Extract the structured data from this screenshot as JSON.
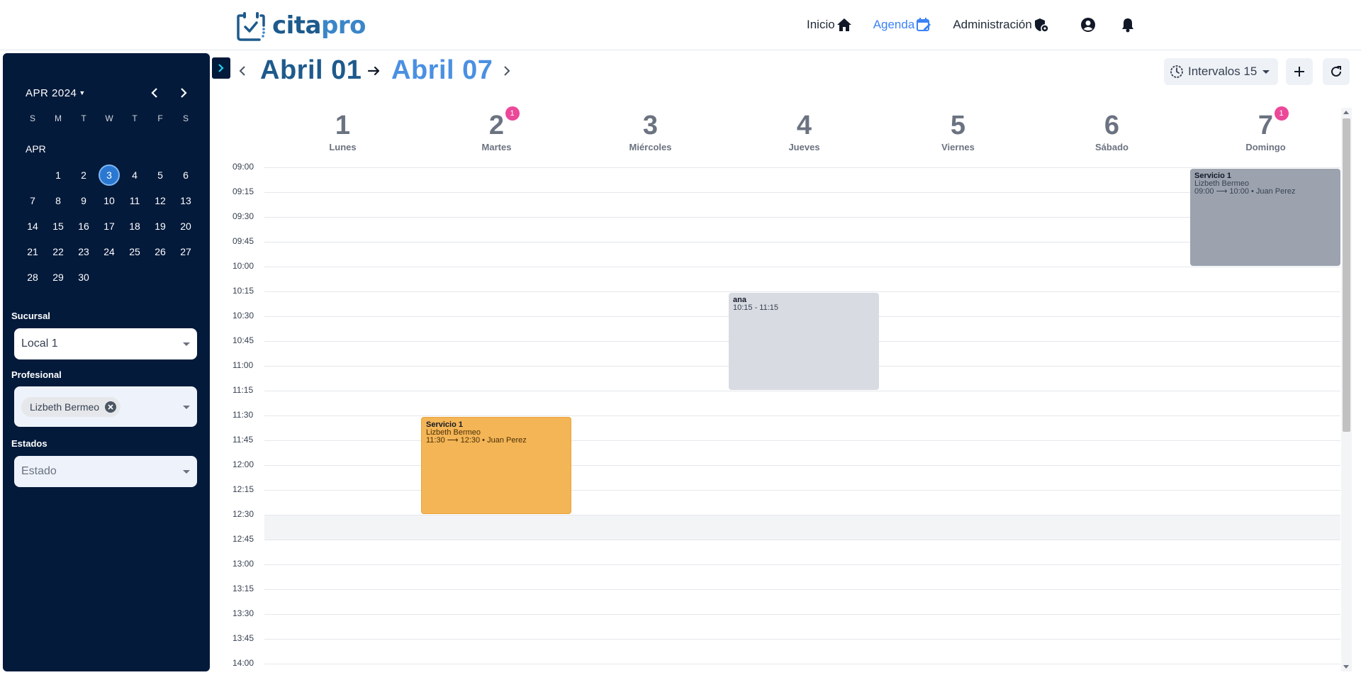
{
  "header": {
    "logo_text_1": "cita",
    "logo_text_2": "pro",
    "nav": [
      {
        "label": "Inicio",
        "icon": "home-icon",
        "active": false
      },
      {
        "label": "Agenda",
        "icon": "calendar-edit-icon",
        "active": true
      },
      {
        "label": "Administración",
        "icon": "shield-admin-icon",
        "active": false
      }
    ],
    "profile_icon": "user-circle-icon",
    "notifications_icon": "bell-icon"
  },
  "sidebar": {
    "mini_calendar": {
      "title": "APR 2024",
      "weekdays": [
        "S",
        "M",
        "T",
        "W",
        "T",
        "F",
        "S"
      ],
      "month_label": "APR",
      "weeks": [
        [
          "",
          "1",
          "2",
          "3",
          "4",
          "5",
          "6"
        ],
        [
          "7",
          "8",
          "9",
          "10",
          "11",
          "12",
          "13"
        ],
        [
          "14",
          "15",
          "16",
          "17",
          "18",
          "19",
          "20"
        ],
        [
          "21",
          "22",
          "23",
          "24",
          "25",
          "26",
          "27"
        ],
        [
          "28",
          "29",
          "30",
          "",
          "",
          "",
          ""
        ]
      ],
      "selected_day": "3"
    },
    "filters": {
      "sucursal_label": "Sucursal",
      "sucursal_value": "Local 1",
      "profesional_label": "Profesional",
      "profesional_chip": "Lizbeth Bermeo",
      "estados_label": "Estados",
      "estados_placeholder": "Estado"
    }
  },
  "toolbar": {
    "range_start": "Abril 01",
    "range_end": "Abril 07",
    "interval_label": "Intervalos 15"
  },
  "calendar": {
    "days": [
      {
        "num": "1",
        "name": "Lunes",
        "badge": ""
      },
      {
        "num": "2",
        "name": "Martes",
        "badge": "1"
      },
      {
        "num": "3",
        "name": "Miércoles",
        "badge": ""
      },
      {
        "num": "4",
        "name": "Jueves",
        "badge": ""
      },
      {
        "num": "5",
        "name": "Viernes",
        "badge": ""
      },
      {
        "num": "6",
        "name": "Sábado",
        "badge": ""
      },
      {
        "num": "7",
        "name": "Domingo",
        "badge": "1"
      }
    ],
    "times": [
      "09:00",
      "09:15",
      "09:30",
      "09:45",
      "10:00",
      "10:15",
      "10:30",
      "10:45",
      "11:00",
      "11:15",
      "11:30",
      "11:45",
      "12:00",
      "12:15",
      "12:30",
      "12:45",
      "13:00",
      "13:15",
      "13:30",
      "13:45",
      "14:00"
    ],
    "shaded_slot": "12:30",
    "events": [
      {
        "day": 7,
        "start": "09:00",
        "end": "10:00",
        "title": "Servicio 1",
        "line2": "Lizbeth Bermeo",
        "line3": "09:00 ⟶ 10:00 • Juan Perez",
        "style": "ev-gray"
      },
      {
        "day": 4,
        "start": "10:15",
        "end": "11:15",
        "title": "ana",
        "line2": "10:15 - 11:15",
        "line3": "",
        "style": "ev-light"
      },
      {
        "day": 2,
        "start": "11:30",
        "end": "12:30",
        "title": "Servicio 1",
        "line2": "Lizbeth Bermeo",
        "line3": "11:30 ⟶ 12:30 • Juan Perez",
        "style": "ev-orange"
      }
    ]
  }
}
